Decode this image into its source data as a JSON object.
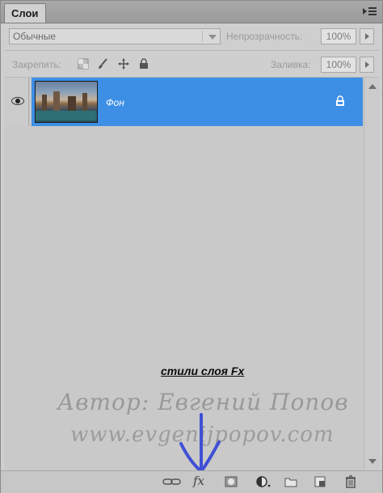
{
  "panel": {
    "tab_label": "Слои",
    "menu_icon": "panel-menu-icon"
  },
  "blend": {
    "mode": "Обычные",
    "opacity_label": "Непрозрачность:",
    "opacity_value": "100%"
  },
  "lock": {
    "label": "Закрепить:",
    "icons": [
      "lock-transparent-icon",
      "lock-paint-icon",
      "lock-move-icon",
      "lock-all-icon"
    ],
    "fill_label": "Заливка:",
    "fill_value": "100%"
  },
  "layers": [
    {
      "name": "Фон",
      "visible": true,
      "selected": true,
      "locked": true
    }
  ],
  "annotation": {
    "caption": "стили слоя Fx",
    "watermark_line1": "Автор: Евгений Попов",
    "watermark_line2": "www.evgenijpopov.com"
  },
  "footer": {
    "icons": [
      "link-layers-icon",
      "fx-icon",
      "layer-mask-icon",
      "adjustment-layer-icon",
      "new-group-icon",
      "new-layer-icon",
      "trash-icon"
    ],
    "fx_label": "fx"
  },
  "colors": {
    "selection": "#3d8ee5",
    "panel_bg": "#cfcfcf",
    "annotation_stroke": "#3f4fd6"
  }
}
